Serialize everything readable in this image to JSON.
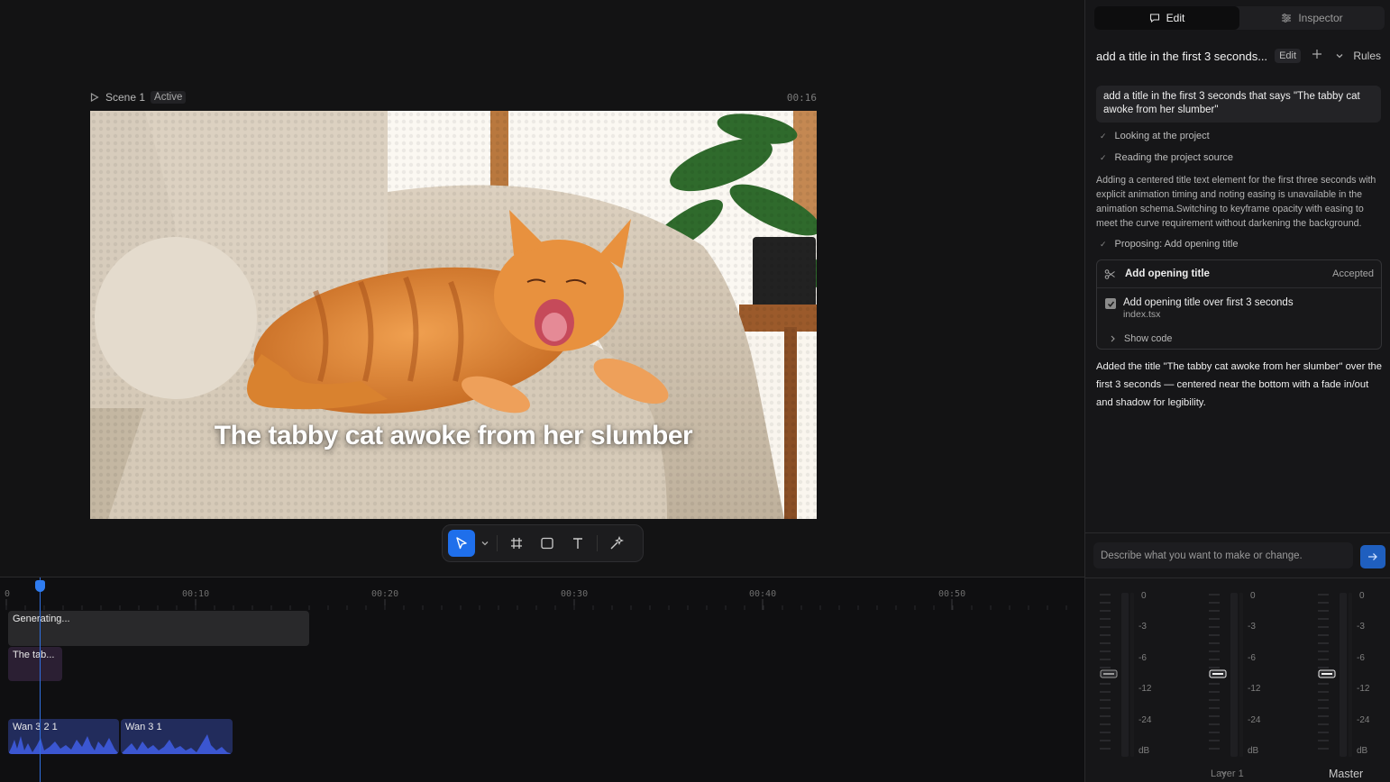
{
  "scene": {
    "name": "Scene 1",
    "status": "Active",
    "time": "00:16",
    "title_text": "The tabby cat awoke from her slumber"
  },
  "toolbar": {
    "tools": [
      "select-arrow-icon",
      "chevron-down-icon",
      "grid-hash-icon",
      "rectangle-icon",
      "text-t-icon",
      "sparkle-magic-icon"
    ]
  },
  "panel": {
    "tabs": [
      {
        "label": "Edit",
        "icon": "chat-bubble-icon",
        "active": true
      },
      {
        "label": "Inspector",
        "icon": "sliders-icon",
        "active": false
      }
    ],
    "thread": {
      "title": "add a title in the first 3 seconds...",
      "edit_label": "Edit",
      "rules_label": "Rules"
    },
    "user_message": "add a title in the first 3 seconds that says \"The tabby cat awoke from her slumber\"",
    "steps": [
      "Looking at the project",
      "Reading the project source"
    ],
    "reasoning": "Adding a centered title text element for the first three seconds with explicit animation timing and noting easing is unavailable in the animation schema.Switching to keyframe opacity with easing to meet the curve requirement without darkening the background.",
    "proposal_step": "Proposing: Add opening title",
    "change_card": {
      "name": "Add opening title",
      "status": "Accepted",
      "item_title": "Add opening title over first 3 seconds",
      "item_file": "index.tsx",
      "show_code": "Show code"
    },
    "final_message": "Added the title \"The tabby cat awoke from her slumber\" over the first 3 seconds — centered near the bottom with a fade in/out and shadow for legibility.",
    "composer_placeholder": "Describe what you want to make or change."
  },
  "mixer": {
    "db_scale": [
      "0",
      "-3",
      "-6",
      "-12",
      "-24",
      "dB"
    ],
    "channel_label": "Layer 1",
    "master_label": "Master"
  },
  "timeline": {
    "ruler": [
      "0",
      "00:10",
      "00:20",
      "00:30",
      "00:40",
      "00:50"
    ],
    "clips": {
      "generating": "Generating...",
      "text": "The tab...",
      "audio1": "Wan 3 2 1",
      "audio2": "Wan 3 1"
    }
  },
  "colors": {
    "accent": "#1f6feb",
    "playhead": "#2f6fe0",
    "audio_clip": "#222c5c",
    "text_clip": "#2b1f33"
  }
}
